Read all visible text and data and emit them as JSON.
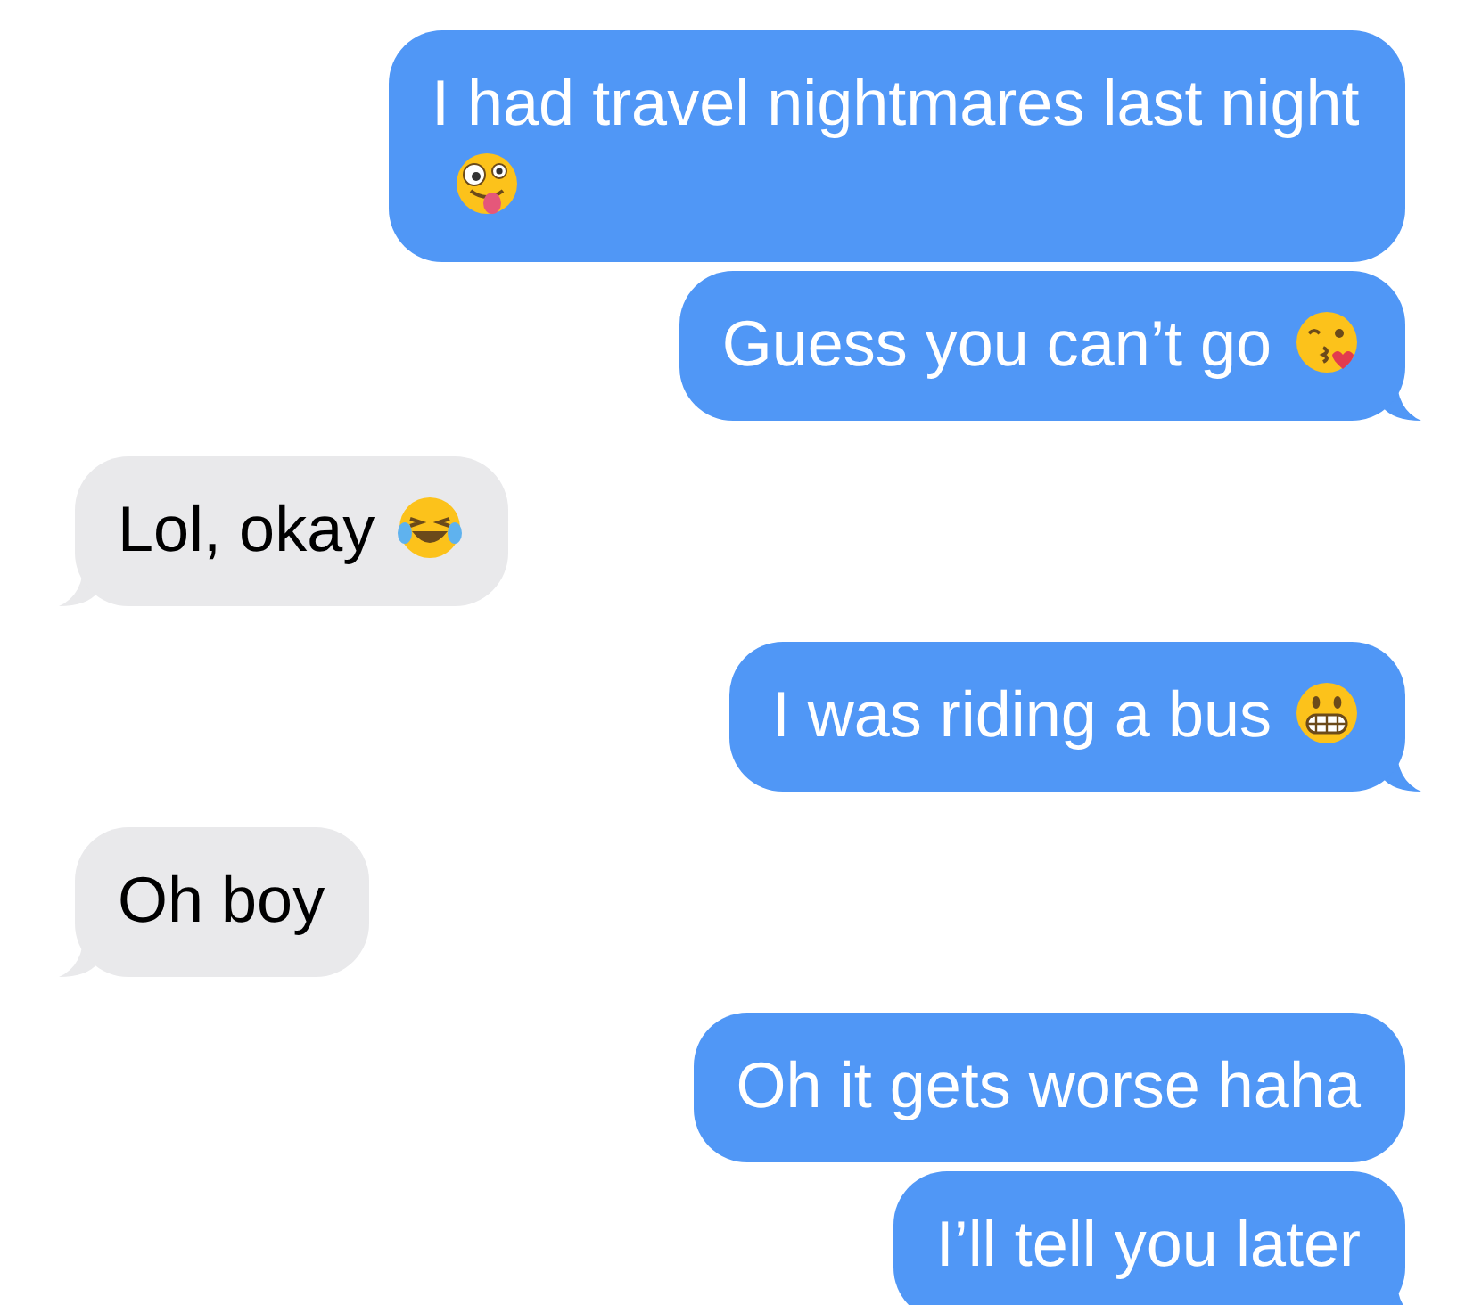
{
  "messages": [
    {
      "kind": "sent",
      "text": "I had travel nightmares last night",
      "emoji": {
        "kind": "zany"
      },
      "tail": false
    },
    {
      "kind": "sent",
      "text": "Guess you can’t go",
      "emoji": {
        "kind": "kiss"
      },
      "tail": true
    },
    {
      "kind": "received",
      "text": "Lol, okay",
      "emoji": {
        "kind": "tears-of-joy"
      },
      "tail": true
    },
    {
      "kind": "sent",
      "text": "I was riding a bus",
      "emoji": {
        "kind": "grimace"
      },
      "tail": true
    },
    {
      "kind": "received",
      "text": "Oh boy",
      "tail": true
    },
    {
      "kind": "sent",
      "text": "Oh it gets worse haha",
      "tail": false
    },
    {
      "kind": "sent",
      "text": "I’ll tell you later",
      "tail": true
    }
  ]
}
